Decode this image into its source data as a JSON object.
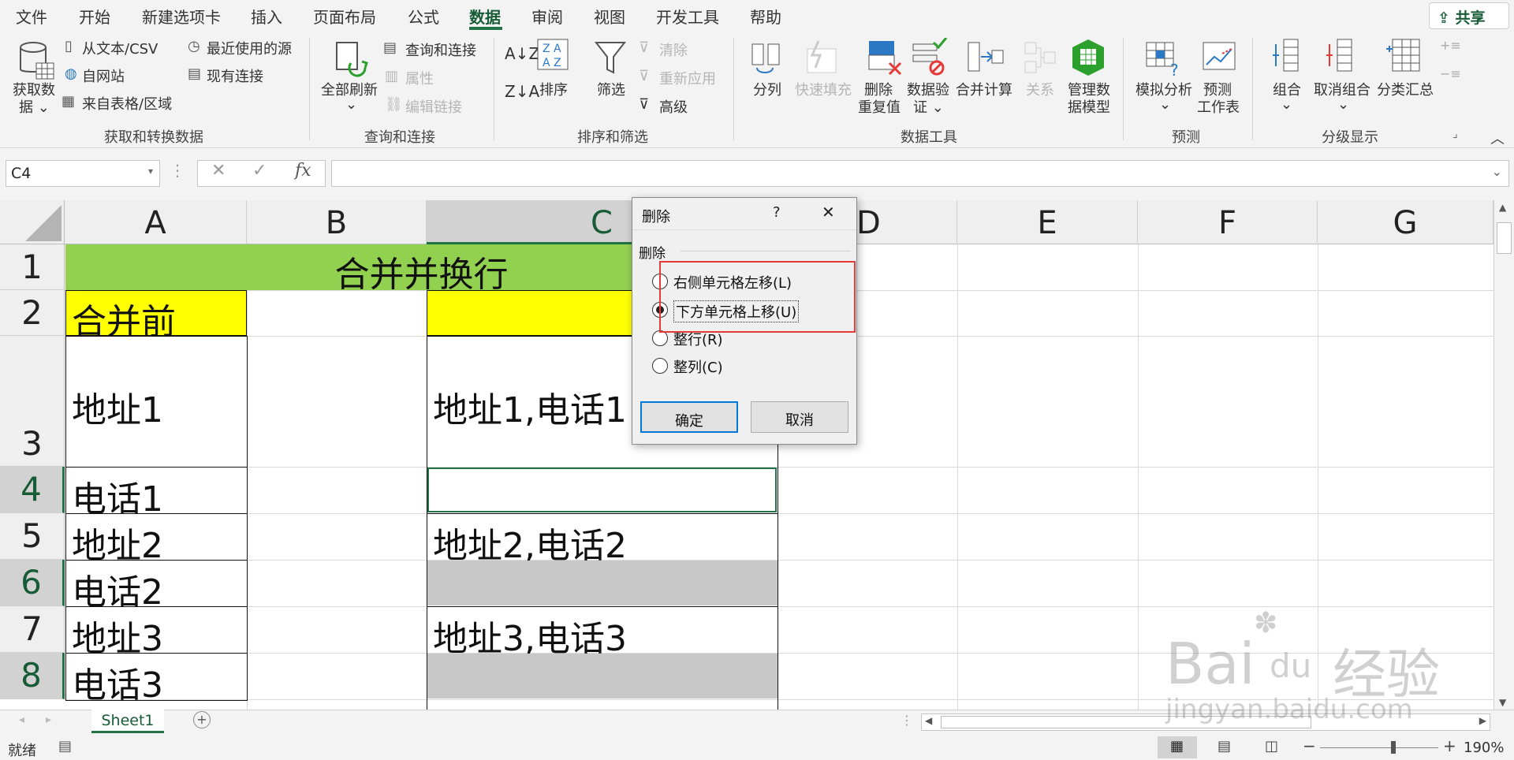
{
  "tabs": [
    "文件",
    "开始",
    "新建选项卡",
    "插入",
    "页面布局",
    "公式",
    "数据",
    "审阅",
    "视图",
    "开发工具",
    "帮助"
  ],
  "share_label": "共享",
  "ribbon": {
    "get_data": [
      "获取数",
      "据 ⌄"
    ],
    "from_text": "从文本/CSV",
    "from_web": "自网站",
    "from_table": "来自表格/区域",
    "recent_sources": "最近使用的源",
    "existing_conn": "现有连接",
    "group1": "获取和转换数据",
    "refresh_all": [
      "全部刷新",
      "⌄"
    ],
    "query_conn": "查询和连接",
    "properties": "属性",
    "edit_links": "编辑链接",
    "group2": "查询和连接",
    "sort": "排序",
    "filter": "筛选",
    "clear": "清除",
    "reapply": "重新应用",
    "advanced": "高级",
    "group3": "排序和筛选",
    "text_to_cols": "分列",
    "flash_fill": "快速填充",
    "remove_dup": [
      "删除",
      "重复值"
    ],
    "validation": [
      "数据验",
      "证 ⌄"
    ],
    "consolidate": "合并计算",
    "relationships": "关系",
    "data_model": [
      "管理数",
      "据模型"
    ],
    "group4": "数据工具",
    "whatif": [
      "模拟分析",
      "⌄"
    ],
    "forecast": [
      "预测",
      "工作表"
    ],
    "group5": "预测",
    "group_btn": [
      "组合",
      "⌄"
    ],
    "ungroup": [
      "取消组合",
      "⌄"
    ],
    "subtotal": "分类汇总",
    "group6": "分级显示"
  },
  "namebox": "C4",
  "fx": "fx",
  "columns": [
    "A",
    "B",
    "C",
    "D",
    "E",
    "F",
    "G"
  ],
  "rows": [
    "1",
    "2",
    "3",
    "4",
    "5",
    "6",
    "7",
    "8"
  ],
  "cells": {
    "title": "合并并换行",
    "a2": "合并前",
    "a3": "地址1",
    "c3": "地址1,电话1",
    "a4": "电话1",
    "a5": "地址2",
    "c5": "地址2,电话2",
    "a6": "电话2",
    "a7": "地址3",
    "c7": "地址3,电话3",
    "a8": "电话3"
  },
  "sheet_tab": "Sheet1",
  "status": {
    "ready": "就绪",
    "zoom": "190%"
  },
  "dialog": {
    "title": "删除",
    "help": "?",
    "group": "删除",
    "options": [
      "右侧单元格左移(L)",
      "下方单元格上移(U)",
      "整行(R)",
      "整列(C)"
    ],
    "selected_index": 1,
    "ok": "确定",
    "cancel": "取消"
  },
  "watermark": {
    "brand": "Bai",
    "du": "du",
    "cn": "经验",
    "url": "jingyan.baidu.com"
  },
  "colors": {
    "green_fill": "#92d050",
    "yellow_fill": "#ffff00",
    "gray_fill": "#c8c8c8",
    "excel_green": "#217346",
    "highlight": "#e53935"
  }
}
